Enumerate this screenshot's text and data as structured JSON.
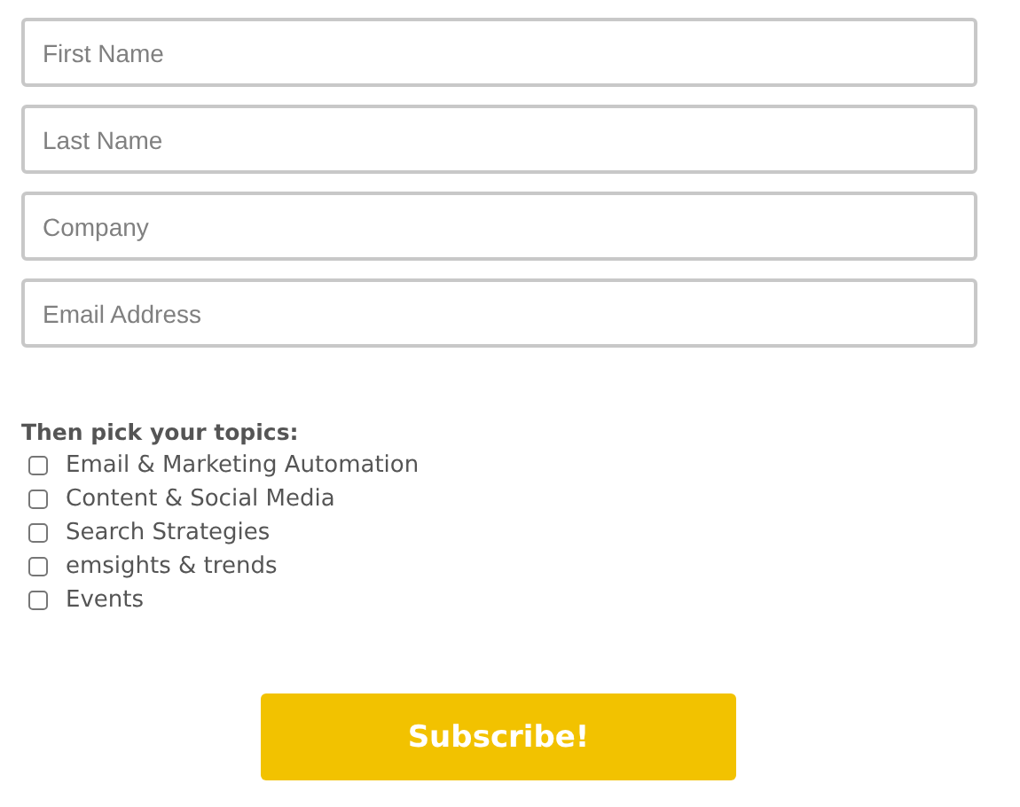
{
  "fields": [
    {
      "placeholder": "First Name"
    },
    {
      "placeholder": "Last Name"
    },
    {
      "placeholder": "Company"
    },
    {
      "placeholder": "Email Address"
    }
  ],
  "topics_heading": "Then pick your topics:",
  "topics": [
    {
      "label": "Email & Marketing Automation",
      "checked": false
    },
    {
      "label": "Content & Social Media",
      "checked": false
    },
    {
      "label": "Search Strategies",
      "checked": false
    },
    {
      "label": "emsights & trends",
      "checked": false
    },
    {
      "label": "Events",
      "checked": false
    }
  ],
  "submit_button": "Subscribe!"
}
